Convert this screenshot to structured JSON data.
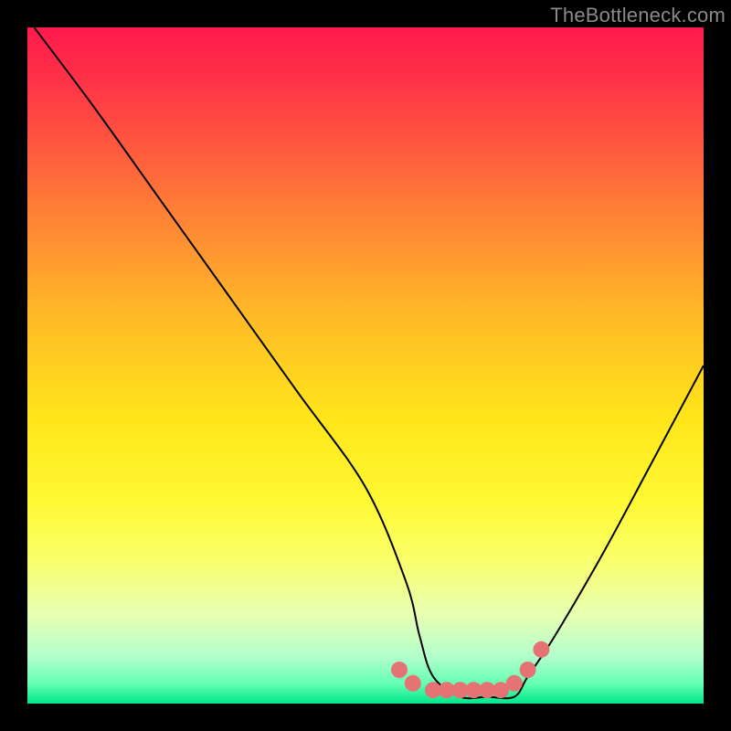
{
  "watermark": "TheBottleneck.com",
  "chart_data": {
    "type": "line",
    "title": "",
    "xlabel": "",
    "ylabel": "",
    "xlim": [
      0,
      100
    ],
    "ylim": [
      0,
      100
    ],
    "grid": false,
    "legend": false,
    "series": [
      {
        "name": "bottleneck-curve",
        "color": "#000000",
        "x": [
          1,
          10,
          20,
          30,
          40,
          50,
          56,
          58,
          60,
          64,
          68,
          72,
          74,
          78,
          85,
          92,
          100
        ],
        "y": [
          100,
          88,
          74,
          60,
          46,
          32,
          18,
          10,
          4,
          1,
          1,
          1,
          4,
          10,
          22,
          35,
          50
        ]
      },
      {
        "name": "highlight-dots",
        "color": "#e57373",
        "type": "scatter",
        "x": [
          55,
          57,
          60,
          62,
          64,
          66,
          68,
          70,
          72,
          74,
          76
        ],
        "y": [
          5,
          3,
          2,
          2,
          2,
          2,
          2,
          2,
          3,
          5,
          8
        ]
      }
    ],
    "annotations": []
  }
}
